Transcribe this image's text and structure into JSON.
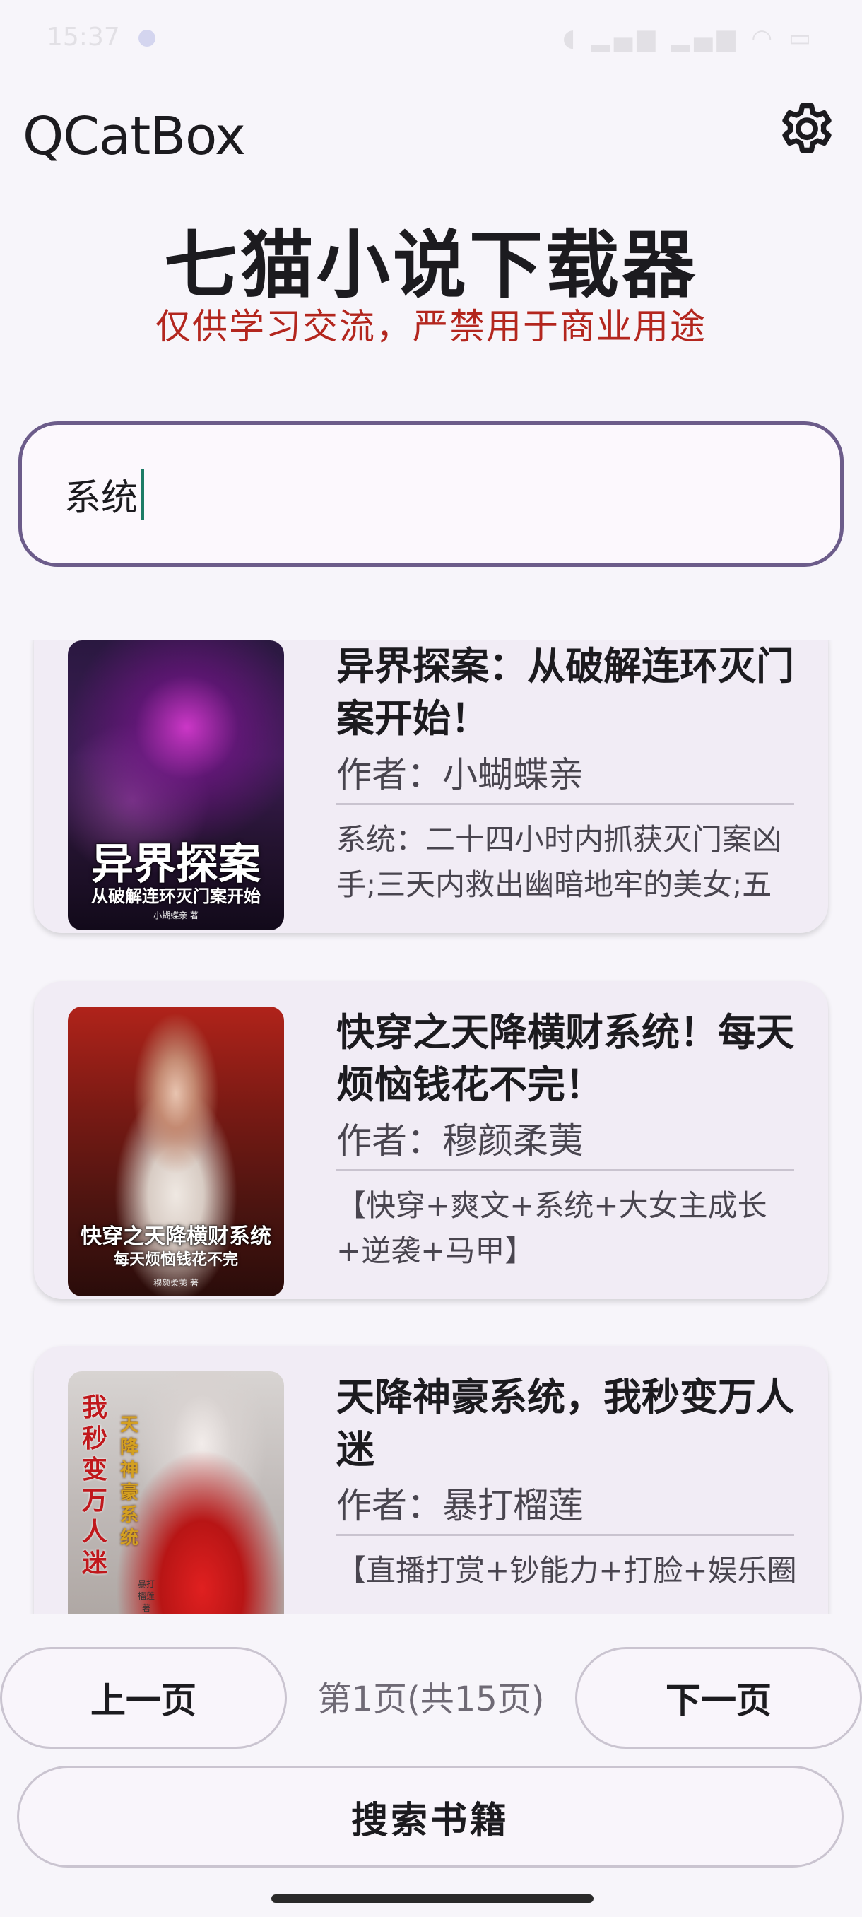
{
  "status_bar": {
    "time": "15:37",
    "icons": "◖ ▂▄▆ ▂▄▆ ◠ ▭"
  },
  "app_bar": {
    "title": "QCatBox",
    "settings_icon": "gear-icon"
  },
  "header": {
    "title": "七猫小说下载器",
    "subtitle": "仅供学习交流，严禁用于商业用途"
  },
  "search": {
    "value": "系统"
  },
  "books": [
    {
      "title": "异界探案：从破解连环灭门案开始！",
      "author": "作者：小蝴蝶亲",
      "description": "系统：二十四小时内抓获灭门案凶手;三天内救出幽暗地牢的美女;五",
      "cover_title": "异界探案",
      "cover_subtitle": "从破解连环灭门案开始",
      "cover_author": "小蝴蝶亲 著"
    },
    {
      "title": "快穿之天降横财系统！每天烦恼钱花不完！",
      "author": "作者：穆颜柔荑",
      "description": "【快穿+爽文+系统+大女主成长+逆袭+马甲】",
      "cover_title": "快穿之天降横财系统",
      "cover_subtitle": "每天烦恼钱花不完",
      "cover_author": "穆颜柔荑 著"
    },
    {
      "title": "天降神豪系统，我秒变万人迷",
      "author": "作者：暴打榴莲",
      "description": "【直播打赏+钞能力+打脸+娱乐圈",
      "cover_title": "我秒变万人迷",
      "cover_subtitle": "天降神豪系统",
      "cover_author": "暴打榴莲 著"
    }
  ],
  "pagination": {
    "prev_label": "上一页",
    "page_info": "第1页(共15页)",
    "next_label": "下一页"
  },
  "actions": {
    "search_label": "搜索书籍"
  },
  "colors": {
    "accent_outline": "#6c5c8a",
    "warning_text": "#b3261e",
    "card_bg": "#f1ecf5",
    "caret": "#1d7c66"
  }
}
